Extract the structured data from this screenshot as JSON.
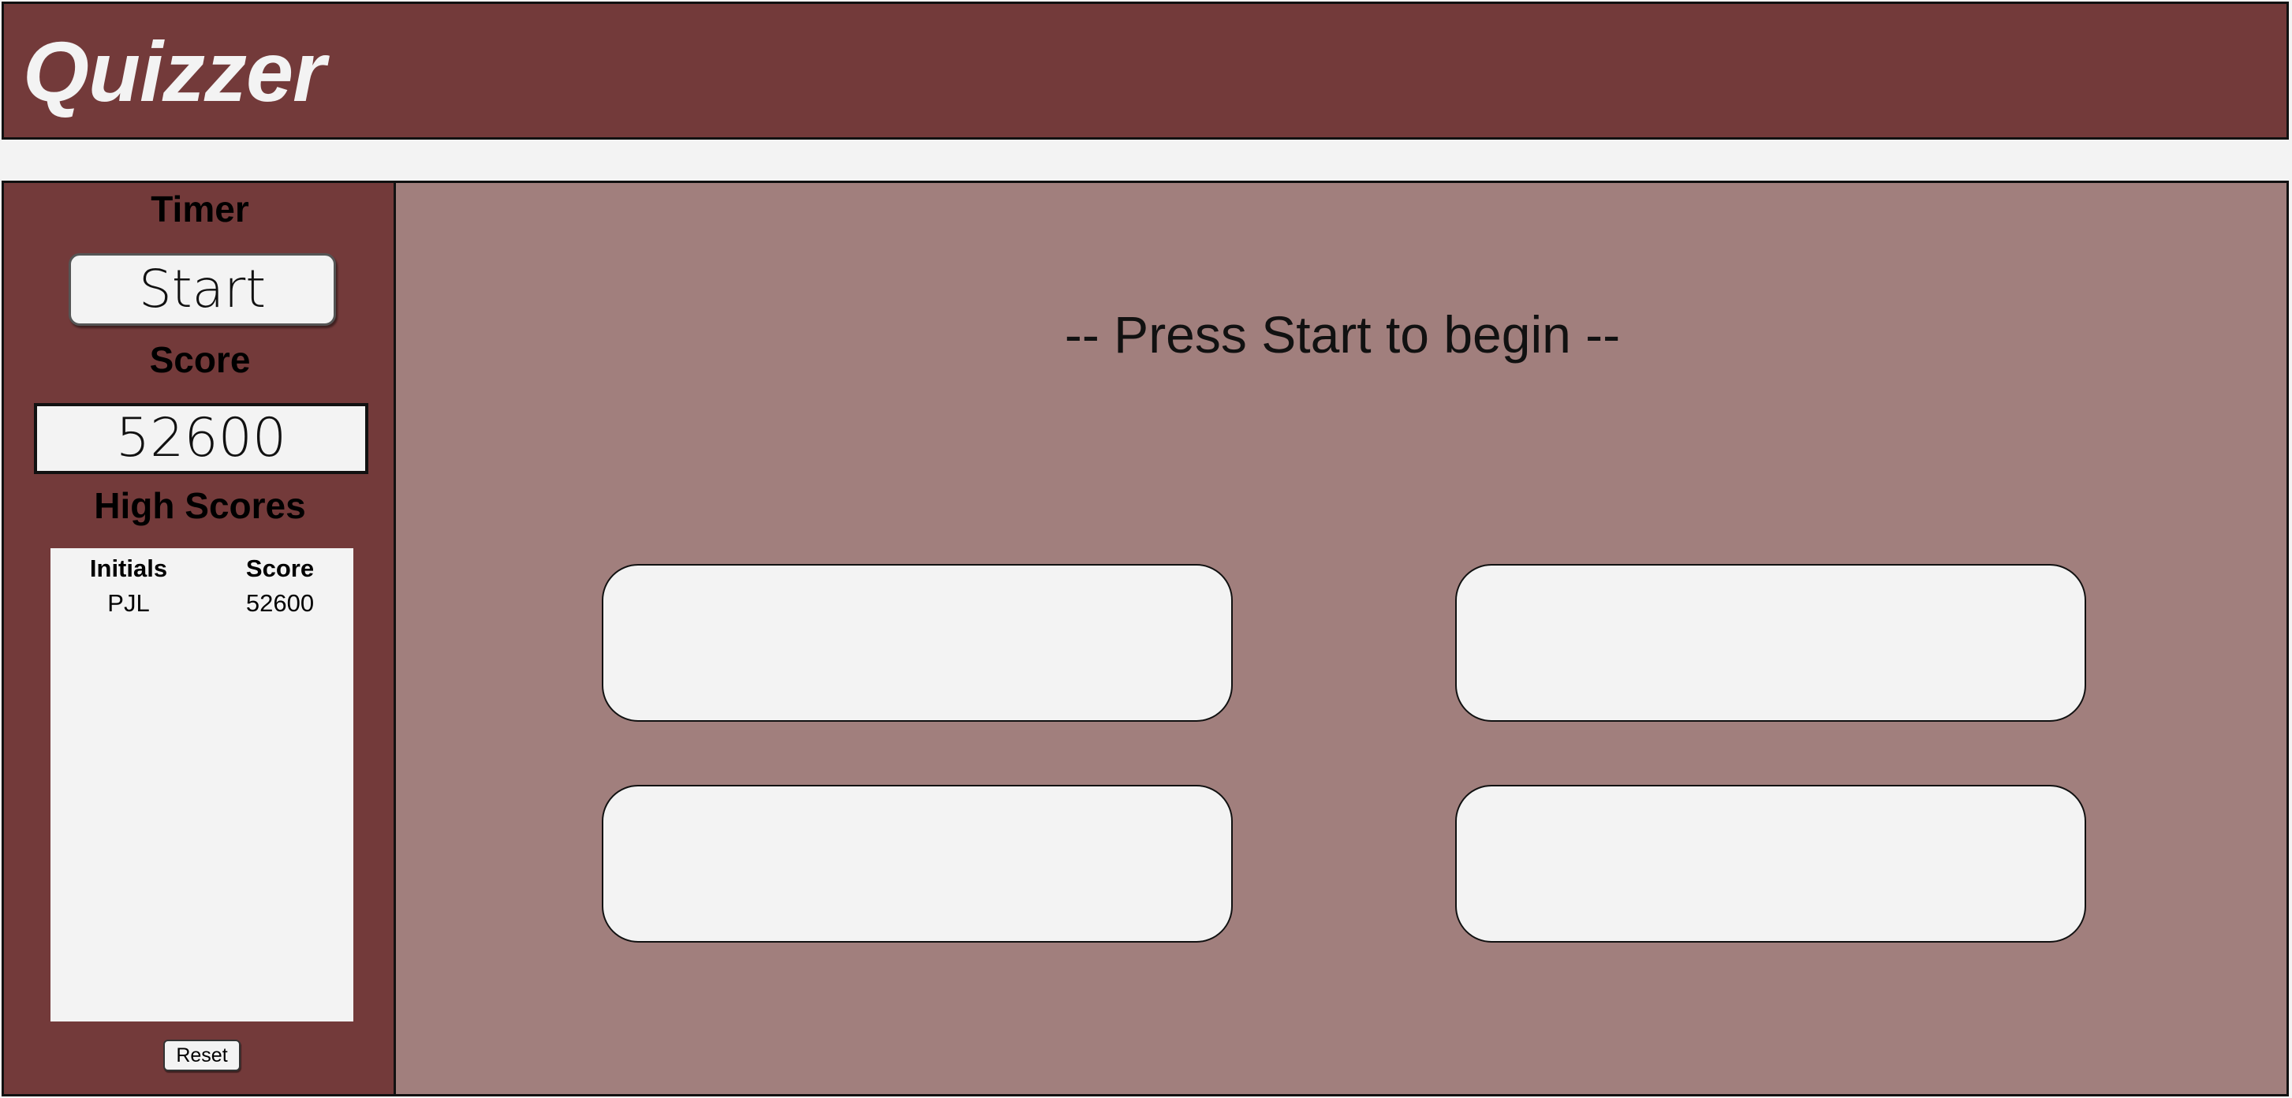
{
  "header": {
    "title": "Quizzer"
  },
  "sidebar": {
    "timer_heading": "Timer",
    "start_label": "Start",
    "score_heading": "Score",
    "score_value": "52600",
    "high_scores_heading": "High Scores",
    "high_scores": {
      "columns": [
        "Initials",
        "Score"
      ],
      "rows": [
        {
          "initials": "PJL",
          "score": "52600"
        }
      ]
    },
    "reset_label": "Reset"
  },
  "quiz": {
    "prompt": "-- Press Start to begin --",
    "answers": [
      "",
      "",
      "",
      ""
    ]
  },
  "colors": {
    "header_bg": "#733a3a",
    "sidebar_bg": "#733a3a",
    "quiz_bg": "#a17f7d",
    "panel_bg": "#f3f3f3",
    "title_text": "#f3f3f3"
  }
}
